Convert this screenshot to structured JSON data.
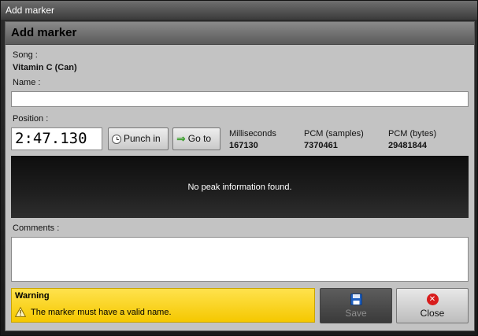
{
  "window": {
    "title": "Add marker"
  },
  "panel": {
    "title": "Add marker"
  },
  "song": {
    "label": "Song :",
    "value": "Vitamin C (Can)"
  },
  "name": {
    "label": "Name :",
    "value": ""
  },
  "position": {
    "label": "Position :",
    "value": "2:47.130",
    "punch_in_label": "Punch in",
    "go_to_label": "Go to",
    "milliseconds_label": "Milliseconds",
    "milliseconds_value": "167130",
    "pcm_samples_label": "PCM (samples)",
    "pcm_samples_value": "7370461",
    "pcm_bytes_label": "PCM (bytes)",
    "pcm_bytes_value": "29481844"
  },
  "waveform": {
    "message": "No peak information found."
  },
  "comments": {
    "label": "Comments :",
    "value": ""
  },
  "warning": {
    "title": "Warning",
    "message": "The marker must have a valid name."
  },
  "actions": {
    "save_label": "Save",
    "close_label": "Close"
  },
  "colors": {
    "warning_bg": "#f5c800",
    "close_icon": "#d81c1c",
    "go_to_arrow": "#2e9a1e",
    "save_icon": "#1f5fbf"
  },
  "icons": {
    "punch_in": "clock-icon",
    "go_to": "arrow-right-icon",
    "warning": "warning-triangle-icon",
    "save": "floppy-disk-icon",
    "close": "close-circle-icon"
  }
}
